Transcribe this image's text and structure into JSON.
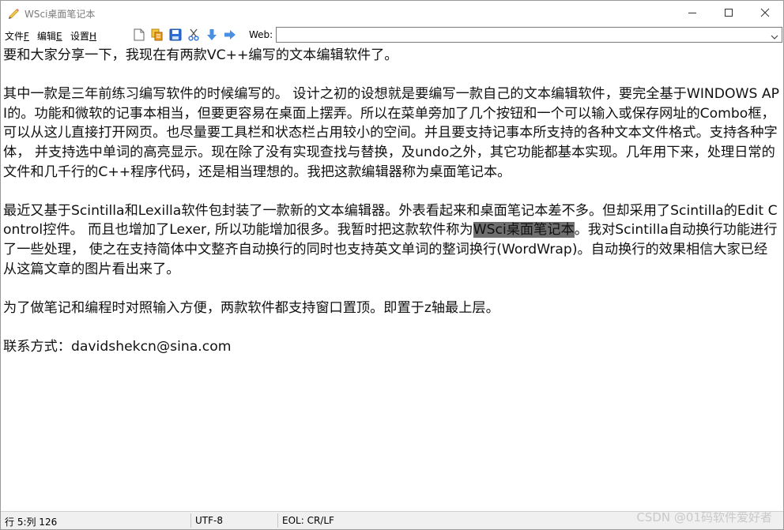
{
  "window": {
    "title": "WSci桌面笔记本",
    "controls": {
      "minimize": "minimize-icon",
      "maximize": "maximize-icon",
      "close": "close-icon"
    }
  },
  "menu": [
    {
      "label": "文件",
      "key": "F"
    },
    {
      "label": "编辑",
      "key": "E"
    },
    {
      "label": "设置",
      "key": "H"
    }
  ],
  "toolbar_icons": [
    "new-file-icon",
    "copy-icon",
    "save-icon",
    "cut-icon",
    "arrow-down-icon",
    "arrow-right-icon"
  ],
  "web": {
    "label": "Web:",
    "value": ""
  },
  "document": {
    "lines": [
      "要和大家分享一下，我现在有两款VC++编写的文本编辑软件了。",
      "",
      "其中一款是三年前练习编写软件的时候编写的。 设计之初的设想就是要编写一款自己的文本编辑软件，要完全基于WINDOWS API的。功能和微软的记事本相当，但要更容易在桌面上摆弄。所以在菜单旁加了几个按钮和一个可以输入或保存网址的Combo框，可以从这儿直接打开网页。也尽量要工具栏和状态栏占用较小的空间。并且要支持记事本所支持的各种文本文件格式。支持各种字体， 并支持选中单词的高亮显示。现在除了没有实现查找与替换，及undo之外，其它功能都基本实现。几年用下来，处理日常的文件和几千行的C++程序代码，还是相当理想的。我把这款编辑器称为桌面笔记本。",
      "",
      {
        "before": "最近又基于Scintilla和Lexilla软件包封装了一款新的文本编辑器。外表看起来和桌面笔记本差不多。但却采用了Scintilla的Edit Control控件。 而且也增加了Lexer, 所以功能增加很多。我暂时把这款软件称为",
        "highlight": "WSci桌面笔记本",
        "after": "。我对Scintilla自动换行功能进行了一些处理， 使之在支持简体中文整齐自动换行的同时也支持英文单词的整词换行(WordWrap)。自动换行的效果相信大家已经从这篇文章的图片看出来了。"
      },
      "",
      "为了做笔记和编程时对照输入方便，两款软件都支持窗口置顶。即置于z轴最上层。",
      "",
      "联系方式：davidshekcn@sina.com"
    ]
  },
  "status": {
    "position": "行 5:列 126",
    "encoding": "UTF-8",
    "eol": "EOL: CR/LF"
  },
  "watermark": "CSDN @01码软件爱好者",
  "colors": {
    "highlight": "#6f6f6f",
    "statusbar": "#f0f0f0",
    "accent_icon": "#2b7de9"
  }
}
